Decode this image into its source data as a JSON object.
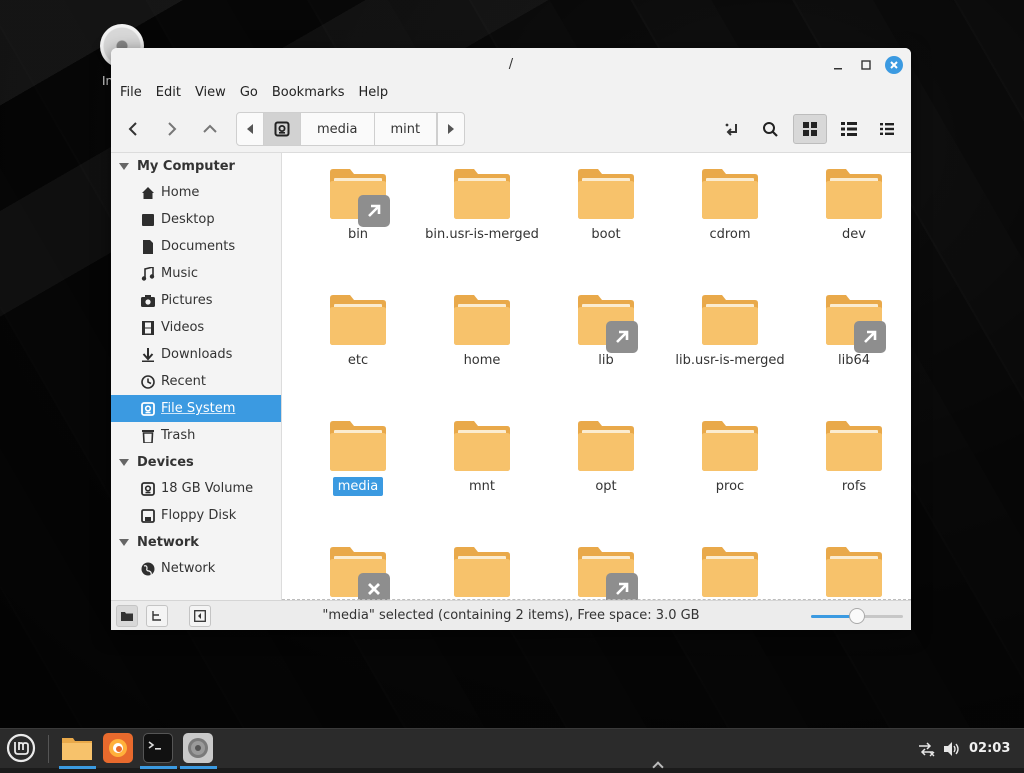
{
  "desktop": {
    "icon_label": "In"
  },
  "window": {
    "title": "/",
    "menu": [
      "File",
      "Edit",
      "View",
      "Go",
      "Bookmarks",
      "Help"
    ]
  },
  "breadcrumbs": [
    "media",
    "mint"
  ],
  "sidebar": {
    "sections": [
      {
        "label": "My Computer",
        "items": [
          "Home",
          "Desktop",
          "Documents",
          "Music",
          "Pictures",
          "Videos",
          "Downloads",
          "Recent",
          "File System",
          "Trash"
        ]
      },
      {
        "label": "Devices",
        "items": [
          "18 GB Volume",
          "Floppy Disk"
        ]
      },
      {
        "label": "Network",
        "items": [
          "Network"
        ]
      }
    ],
    "selected": "File System"
  },
  "folders": [
    {
      "name": "bin",
      "emblem": "symlink"
    },
    {
      "name": "bin.usr-is-merged",
      "emblem": ""
    },
    {
      "name": "boot",
      "emblem": ""
    },
    {
      "name": "cdrom",
      "emblem": ""
    },
    {
      "name": "dev",
      "emblem": ""
    },
    {
      "name": "etc",
      "emblem": ""
    },
    {
      "name": "home",
      "emblem": ""
    },
    {
      "name": "lib",
      "emblem": "symlink"
    },
    {
      "name": "lib.usr-is-merged",
      "emblem": ""
    },
    {
      "name": "lib64",
      "emblem": "symlink"
    },
    {
      "name": "media",
      "emblem": "",
      "selected": true
    },
    {
      "name": "mnt",
      "emblem": ""
    },
    {
      "name": "opt",
      "emblem": ""
    },
    {
      "name": "proc",
      "emblem": ""
    },
    {
      "name": "rofs",
      "emblem": ""
    },
    {
      "name": "",
      "emblem": "unreadable"
    },
    {
      "name": "",
      "emblem": ""
    },
    {
      "name": "",
      "emblem": "symlink"
    },
    {
      "name": "",
      "emblem": ""
    },
    {
      "name": "",
      "emblem": ""
    }
  ],
  "status": {
    "text": "\"media\" selected (containing 2 items), Free space: 3.0 GB",
    "zoom_fraction": 0.5
  },
  "taskbar": {
    "clock": "02:03"
  },
  "colors": {
    "accent": "#3b9ae1",
    "folder": "#f7c26b",
    "folder_back": "#e9a94a"
  }
}
